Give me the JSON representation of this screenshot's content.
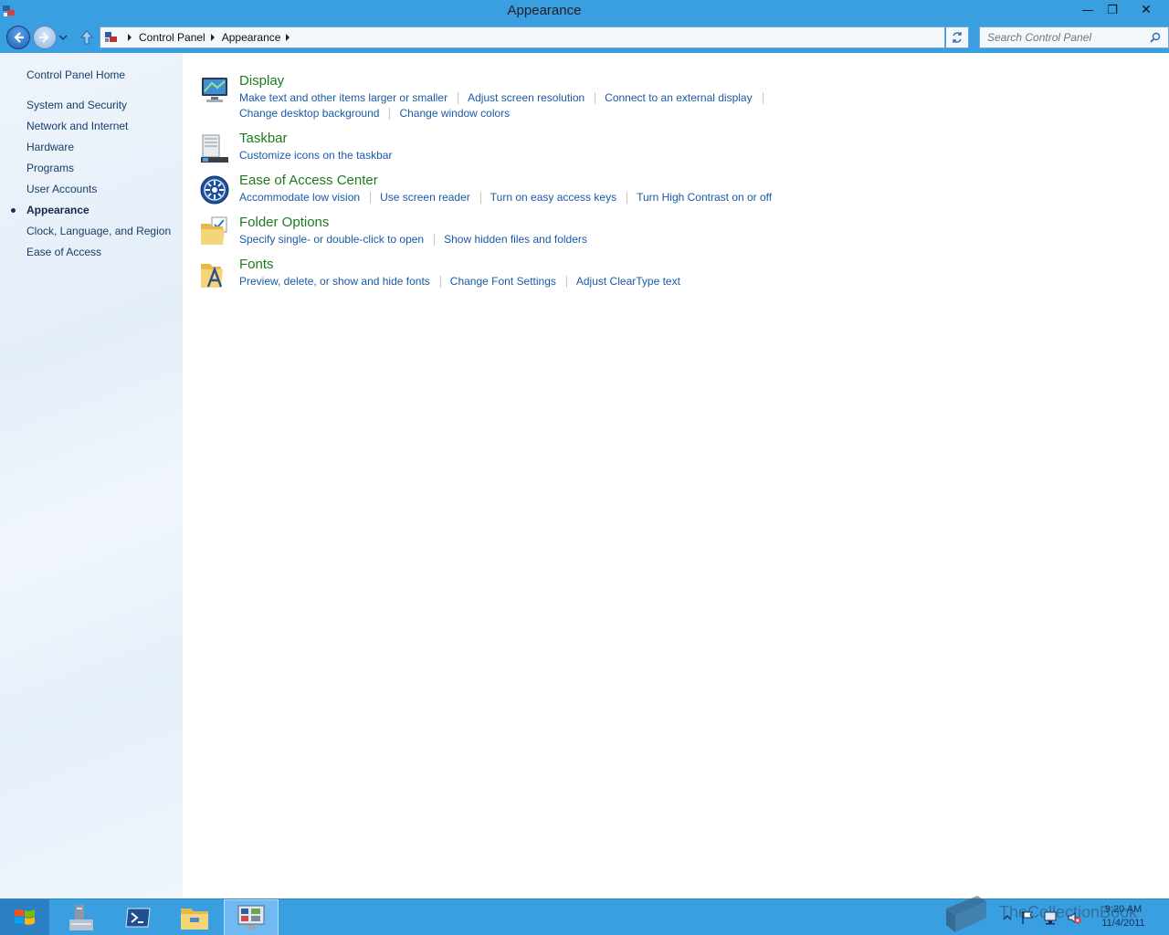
{
  "window": {
    "title": "Appearance",
    "minimize_glyph": "—",
    "maximize_glyph": "❐",
    "close_glyph": "✕"
  },
  "address": {
    "breadcrumbs": [
      "Control Panel",
      "Appearance"
    ],
    "search_placeholder": "Search Control Panel"
  },
  "sidebar": {
    "home": "Control Panel Home",
    "items": [
      {
        "label": "System and Security",
        "current": false
      },
      {
        "label": "Network and Internet",
        "current": false
      },
      {
        "label": "Hardware",
        "current": false
      },
      {
        "label": "Programs",
        "current": false
      },
      {
        "label": "User Accounts",
        "current": false
      },
      {
        "label": "Appearance",
        "current": true
      },
      {
        "label": "Clock, Language, and Region",
        "current": false
      },
      {
        "label": "Ease of Access",
        "current": false
      }
    ]
  },
  "categories": [
    {
      "title": "Display",
      "icon": "display-icon",
      "link_rows": [
        [
          "Make text and other items larger or smaller",
          "Adjust screen resolution",
          "Connect to an external display"
        ],
        [
          "Change desktop background",
          "Change window colors"
        ]
      ]
    },
    {
      "title": "Taskbar",
      "icon": "taskbar-icon",
      "link_rows": [
        [
          "Customize icons on the taskbar"
        ]
      ]
    },
    {
      "title": "Ease of Access Center",
      "icon": "ease-of-access-icon",
      "link_rows": [
        [
          "Accommodate low vision",
          "Use screen reader",
          "Turn on easy access keys",
          "Turn High Contrast on or off"
        ]
      ]
    },
    {
      "title": "Folder Options",
      "icon": "folder-options-icon",
      "link_rows": [
        [
          "Specify single- or double-click to open",
          "Show hidden files and folders"
        ]
      ]
    },
    {
      "title": "Fonts",
      "icon": "fonts-icon",
      "link_rows": [
        [
          "Preview, delete, or show and hide fonts",
          "Change Font Settings",
          "Adjust ClearType text"
        ]
      ]
    }
  ],
  "taskbar": {
    "time": "9:20 AM",
    "date": "11/4/2011",
    "watermark": "TheCollectionBook",
    "accent": "#3a9fe0"
  },
  "colors": {
    "category_title": "#1e7a1e",
    "link": "#1a5aa6",
    "sidebar_link": "#1a3d6a"
  }
}
